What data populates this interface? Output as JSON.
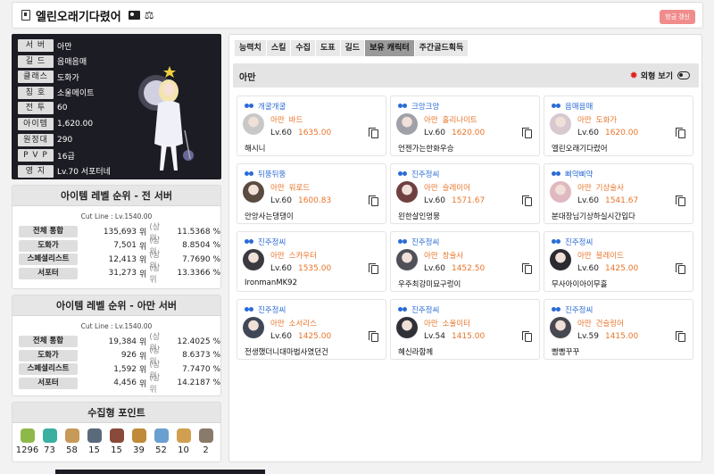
{
  "header": {
    "character_name": "엘린오래기다렸어",
    "refresh_label": "방금 갱신"
  },
  "profile": {
    "stats": [
      {
        "label": "서 버",
        "value": "아만"
      },
      {
        "label": "길 드",
        "value": "음매음매"
      },
      {
        "label": "클래스",
        "value": "도화가"
      },
      {
        "label": "칭 호",
        "value": "소울메이트"
      },
      {
        "label": "전 투",
        "value": "60"
      },
      {
        "label": "아이템",
        "value": "1,620.00"
      },
      {
        "label": "원정대",
        "value": "290"
      },
      {
        "label": "P V P",
        "value": "16급"
      },
      {
        "label": "영 지",
        "value": "Lv.70 서포터네"
      }
    ]
  },
  "rank_all": {
    "title": "아이템 레벨 순위 - 전 서버",
    "cutline": "Cut Line : Lv.1540.00",
    "rows": [
      {
        "label": "전체 통합",
        "num": "135,693",
        "pct": "11.5368 %"
      },
      {
        "label": "도화가",
        "num": "7,501",
        "pct": "8.8504 %"
      },
      {
        "label": "스페셜리스트",
        "num": "12,413",
        "pct": "7.7690 %"
      },
      {
        "label": "서포터",
        "num": "31,273",
        "pct": "13.3366 %"
      }
    ]
  },
  "rank_server": {
    "title": "아이템 레벨 순위 - 아만 서버",
    "cutline": "Cut Line : Lv.1540.00",
    "rows": [
      {
        "label": "전체 통합",
        "num": "19,384",
        "pct": "12.4025 %"
      },
      {
        "label": "도화가",
        "num": "926",
        "pct": "8.6373 %"
      },
      {
        "label": "스페셜리스트",
        "num": "1,592",
        "pct": "7.7470 %"
      },
      {
        "label": "서포터",
        "num": "4,456",
        "pct": "14.2187 %"
      }
    ]
  },
  "rank_units": {
    "unit": "위",
    "sang": "(상위"
  },
  "collect": {
    "title": "수집형 포인트",
    "items": [
      {
        "icon": "seed-icon",
        "value": "1296",
        "color": "#8fb84a"
      },
      {
        "icon": "island-heart-icon",
        "value": "73",
        "color": "#3ab0a0"
      },
      {
        "icon": "art-icon",
        "value": "58",
        "color": "#c89a5a"
      },
      {
        "icon": "mokoko-shard-icon",
        "value": "15",
        "color": "#5a6a7a"
      },
      {
        "icon": "giant-heart-icon",
        "value": "15",
        "color": "#8a4a3a"
      },
      {
        "icon": "ignea-token-icon",
        "value": "39",
        "color": "#c08a3a"
      },
      {
        "icon": "sea-bounty-icon",
        "value": "52",
        "color": "#6aa0d0"
      },
      {
        "icon": "world-tree-leaf-icon",
        "value": "10",
        "color": "#d0a050"
      },
      {
        "icon": "orpheus-star-icon",
        "value": "2",
        "color": "#8a7a6a"
      }
    ]
  },
  "tabs": [
    "능력치",
    "스킬",
    "수집",
    "도표",
    "길드",
    "보유 캐릭터",
    "주간골드획득"
  ],
  "active_tab": 5,
  "server_bar": {
    "server": "아만",
    "appearance_label": "외형 보기"
  },
  "characters": [
    {
      "guild": "개굴개굴",
      "server": "아만",
      "cls": "바드",
      "lv": "60",
      "ilvl": "1635.00",
      "name": "해시니",
      "avatar": "#c8c8c8"
    },
    {
      "guild": "크앙크앙",
      "server": "아만",
      "cls": "홀리나이트",
      "lv": "60",
      "ilvl": "1620.00",
      "name": "언젠가는한화우승",
      "avatar": "#a0a0a8"
    },
    {
      "guild": "음매음매",
      "server": "아만",
      "cls": "도화가",
      "lv": "60",
      "ilvl": "1620.00",
      "name": "엘린오래기다렸어",
      "avatar": "#d8c8d0"
    },
    {
      "guild": "뒤뚱뒤뚱",
      "server": "아만",
      "cls": "워로드",
      "lv": "60",
      "ilvl": "1600.83",
      "name": "안앙사는댕댕이",
      "avatar": "#5a4a40"
    },
    {
      "guild": "진주정씨",
      "server": "아만",
      "cls": "슬레이어",
      "lv": "60",
      "ilvl": "1571.67",
      "name": "왼한살인멍뭉",
      "avatar": "#704040"
    },
    {
      "guild": "삐약삐약",
      "server": "아만",
      "cls": "기상술사",
      "lv": "60",
      "ilvl": "1541.67",
      "name": "분대장님기상하실시간입다",
      "avatar": "#e0b8c0"
    },
    {
      "guild": "진주정씨",
      "server": "아만",
      "cls": "스카우터",
      "lv": "60",
      "ilvl": "1535.00",
      "name": "IronmanMK92",
      "avatar": "#3a3a40"
    },
    {
      "guild": "진주정씨",
      "server": "아만",
      "cls": "창술사",
      "lv": "60",
      "ilvl": "1452.50",
      "name": "우주최강미묘구렁이",
      "avatar": "#505058"
    },
    {
      "guild": "진주정씨",
      "server": "아만",
      "cls": "블레이드",
      "lv": "60",
      "ilvl": "1425.00",
      "name": "무사아이아이무흘",
      "avatar": "#2a2a30"
    },
    {
      "guild": "진주정씨",
      "server": "아만",
      "cls": "소서리스",
      "lv": "60",
      "ilvl": "1425.00",
      "name": "전생했더니대마법사였던건",
      "avatar": "#404858"
    },
    {
      "guild": "진주정씨",
      "server": "아만",
      "cls": "소울이터",
      "lv": "54",
      "ilvl": "1415.00",
      "name": "혜신라함께",
      "avatar": "#303038"
    },
    {
      "guild": "진주정씨",
      "server": "아만",
      "cls": "건슬링어",
      "lv": "59",
      "ilvl": "1415.00",
      "name": "빰빰꾸꾸",
      "avatar": "#484850"
    }
  ],
  "lv_prefix": "Lv."
}
